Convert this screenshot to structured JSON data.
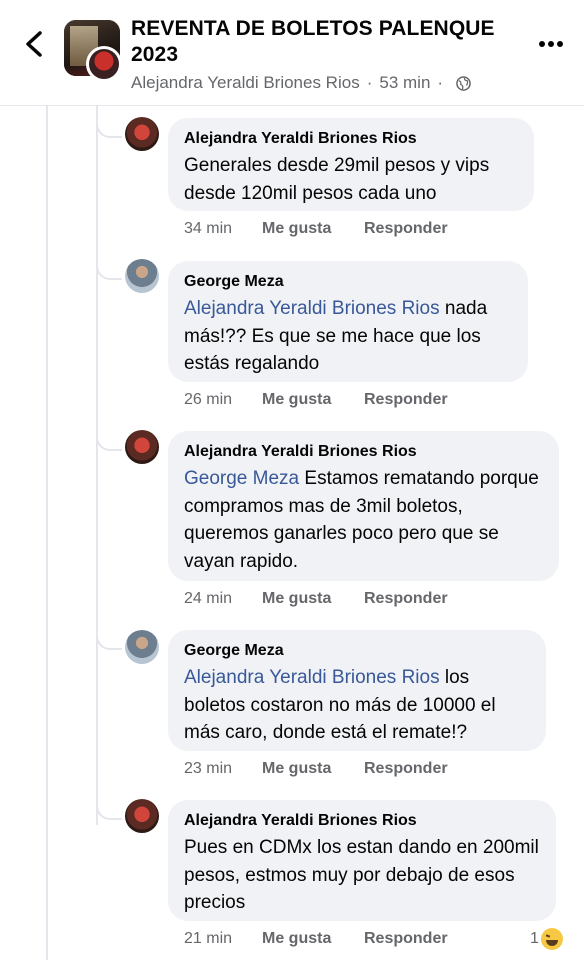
{
  "header": {
    "title": "REVENTA DE BOLETOS PALENQUE 2023",
    "author": "Alejandra Yeraldi Briones Rios",
    "time": "53 min",
    "separator": "·"
  },
  "comments": [
    {
      "author": "Alejandra Yeraldi Briones Rios",
      "mention": "",
      "text": "Generales desde 29mil pesos y vips desde 120mil pesos cada uno",
      "time": "34 min",
      "like": "Me gusta",
      "reply": "Responder"
    },
    {
      "author": "George Meza",
      "mention": "Alejandra Yeraldi Briones Rios",
      "text": " nada más!?? Es que se me hace que los estás regalando",
      "time": "26 min",
      "like": "Me gusta",
      "reply": "Responder"
    },
    {
      "author": "Alejandra Yeraldi Briones Rios",
      "mention": "George Meza",
      "text": " Estamos rematando porque compramos mas de 3mil boletos, queremos ganarles poco pero que se vayan rapido.",
      "time": "24 min",
      "like": "Me gusta",
      "reply": "Responder"
    },
    {
      "author": "George Meza",
      "mention": "Alejandra Yeraldi Briones Rios",
      "text": " los boletos costaron no más de 10000 el más caro, donde está el remate!?",
      "time": "23 min",
      "like": "Me gusta",
      "reply": "Responder"
    },
    {
      "author": "Alejandra Yeraldi Briones Rios",
      "mention": "",
      "text": "Pues en CDMx los estan dando en 200mil pesos, estmos muy por debajo de esos precios",
      "time": "21 min",
      "like": "Me gusta",
      "reply": "Responder",
      "reaction_count": "1",
      "reaction": "haha-emoji"
    }
  ]
}
